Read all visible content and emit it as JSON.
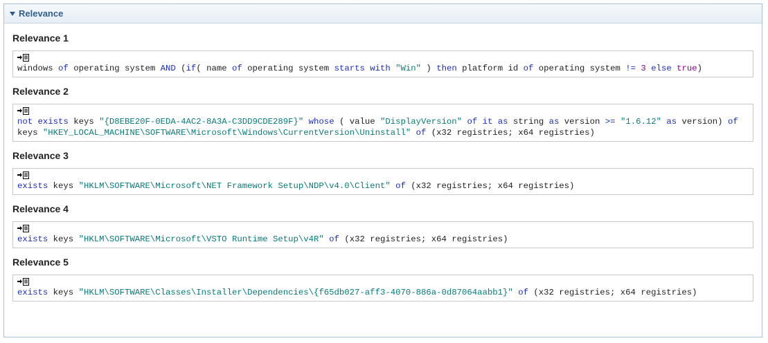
{
  "panel": {
    "title": "Relevance"
  },
  "colors": {
    "keyword": "#1f2fb0",
    "string": "#0a7a7a",
    "literal": "#8b008b",
    "header_text": "#2e5f8f"
  },
  "icons": {
    "collapse": "triangle-down-icon",
    "copy": "copy-to-clipboard-icon"
  },
  "sections": [
    {
      "heading": "Relevance 1",
      "tokens": [
        {
          "t": "windows ",
          "c": "p"
        },
        {
          "t": "of",
          "c": "kw"
        },
        {
          "t": " operating system ",
          "c": "p"
        },
        {
          "t": "AND",
          "c": "kw"
        },
        {
          "t": " (",
          "c": "p"
        },
        {
          "t": "if",
          "c": "kw"
        },
        {
          "t": "( name ",
          "c": "p"
        },
        {
          "t": "of",
          "c": "kw"
        },
        {
          "t": " operating system ",
          "c": "p"
        },
        {
          "t": "starts with",
          "c": "kw"
        },
        {
          "t": " ",
          "c": "p"
        },
        {
          "t": "\"Win\"",
          "c": "str"
        },
        {
          "t": " ) ",
          "c": "p"
        },
        {
          "t": "then",
          "c": "kw"
        },
        {
          "t": " platform id ",
          "c": "p"
        },
        {
          "t": "of",
          "c": "kw"
        },
        {
          "t": " operating system ",
          "c": "p"
        },
        {
          "t": "!=",
          "c": "kw"
        },
        {
          "t": " ",
          "c": "p"
        },
        {
          "t": "3",
          "c": "lit"
        },
        {
          "t": " ",
          "c": "p"
        },
        {
          "t": "else",
          "c": "kw"
        },
        {
          "t": " ",
          "c": "p"
        },
        {
          "t": "true",
          "c": "lit"
        },
        {
          "t": ")",
          "c": "p"
        }
      ]
    },
    {
      "heading": "Relevance 2",
      "tokens": [
        {
          "t": "not",
          "c": "kw"
        },
        {
          "t": " ",
          "c": "p"
        },
        {
          "t": "exists",
          "c": "kw"
        },
        {
          "t": " keys ",
          "c": "p"
        },
        {
          "t": "\"{D8EBE20F-0EDA-4AC2-8A3A-C3DD9CDE289F}\"",
          "c": "str"
        },
        {
          "t": " ",
          "c": "p"
        },
        {
          "t": "whose",
          "c": "kw"
        },
        {
          "t": " ( value ",
          "c": "p"
        },
        {
          "t": "\"DisplayVersion\"",
          "c": "str"
        },
        {
          "t": " ",
          "c": "p"
        },
        {
          "t": "of",
          "c": "kw"
        },
        {
          "t": " ",
          "c": "p"
        },
        {
          "t": "it",
          "c": "kw"
        },
        {
          "t": " ",
          "c": "p"
        },
        {
          "t": "as",
          "c": "kw"
        },
        {
          "t": " string ",
          "c": "p"
        },
        {
          "t": "as",
          "c": "kw"
        },
        {
          "t": " version ",
          "c": "p"
        },
        {
          "t": ">=",
          "c": "kw"
        },
        {
          "t": " ",
          "c": "p"
        },
        {
          "t": "\"1.6.12\"",
          "c": "str"
        },
        {
          "t": " ",
          "c": "p"
        },
        {
          "t": "as",
          "c": "kw"
        },
        {
          "t": " version) ",
          "c": "p"
        },
        {
          "t": "of",
          "c": "kw"
        },
        {
          "t": " keys ",
          "c": "p"
        },
        {
          "t": "\"HKEY_LOCAL_MACHINE\\SOFTWARE\\Microsoft\\Windows\\CurrentVersion\\Uninstall\"",
          "c": "str"
        },
        {
          "t": " ",
          "c": "p"
        },
        {
          "t": "of",
          "c": "kw"
        },
        {
          "t": " (x32 registries; x64 registries)",
          "c": "p"
        }
      ]
    },
    {
      "heading": "Relevance 3",
      "tokens": [
        {
          "t": "exists",
          "c": "kw"
        },
        {
          "t": " keys ",
          "c": "p"
        },
        {
          "t": "\"HKLM\\SOFTWARE\\Microsoft\\NET Framework Setup\\NDP\\v4.0\\Client\"",
          "c": "str"
        },
        {
          "t": " ",
          "c": "p"
        },
        {
          "t": "of",
          "c": "kw"
        },
        {
          "t": " (x32 registries; x64 registries)",
          "c": "p"
        }
      ]
    },
    {
      "heading": "Relevance 4",
      "tokens": [
        {
          "t": "exists",
          "c": "kw"
        },
        {
          "t": " keys ",
          "c": "p"
        },
        {
          "t": "\"HKLM\\SOFTWARE\\Microsoft\\VSTO Runtime Setup\\v4R\"",
          "c": "str"
        },
        {
          "t": " ",
          "c": "p"
        },
        {
          "t": "of",
          "c": "kw"
        },
        {
          "t": " (x32 registries; x64 registries)",
          "c": "p"
        }
      ]
    },
    {
      "heading": "Relevance 5",
      "tokens": [
        {
          "t": "exists",
          "c": "kw"
        },
        {
          "t": " keys ",
          "c": "p"
        },
        {
          "t": "\"HKLM\\SOFTWARE\\Classes\\Installer\\Dependencies\\{f65db027-aff3-4070-886a-0d87064aabb1}\"",
          "c": "str"
        },
        {
          "t": " ",
          "c": "p"
        },
        {
          "t": "of",
          "c": "kw"
        },
        {
          "t": " (x32 registries; x64 registries)",
          "c": "p"
        }
      ]
    }
  ]
}
